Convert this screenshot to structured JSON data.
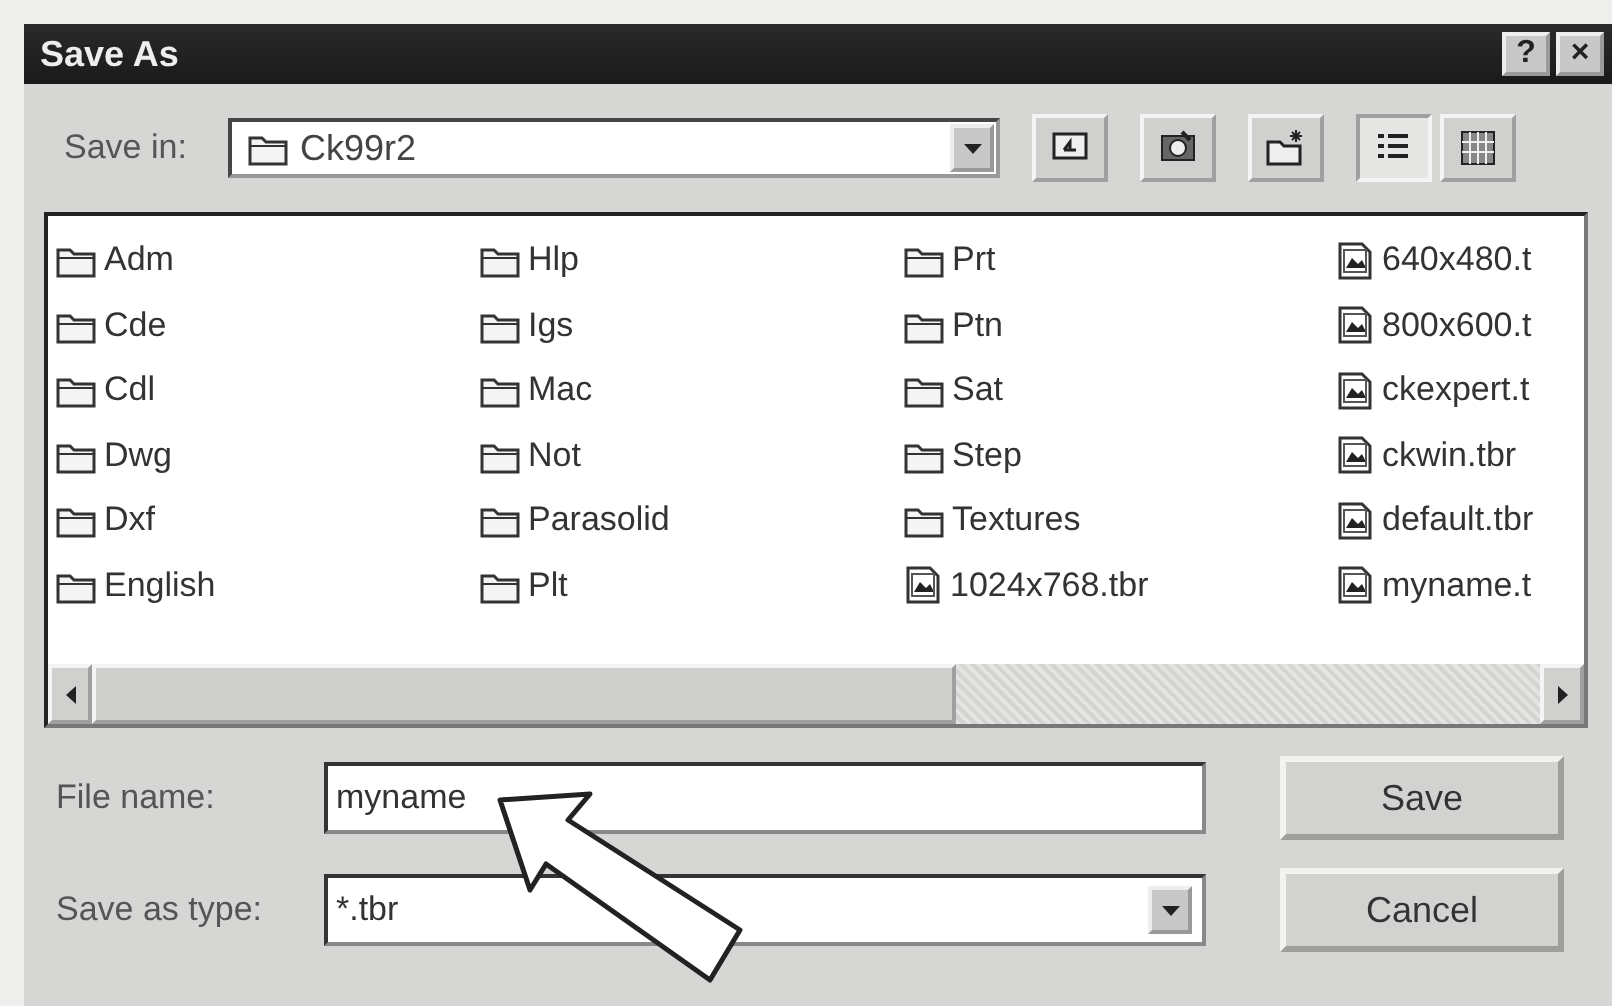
{
  "window": {
    "title": "Save As",
    "help_button": "?",
    "close_button": "×"
  },
  "save_in": {
    "label": "Save in:",
    "value": "Ck99r2"
  },
  "files": [
    {
      "kind": "folder",
      "name": "Adm"
    },
    {
      "kind": "folder",
      "name": "Cde"
    },
    {
      "kind": "folder",
      "name": "Cdl"
    },
    {
      "kind": "folder",
      "name": "Dwg"
    },
    {
      "kind": "folder",
      "name": "Dxf"
    },
    {
      "kind": "folder",
      "name": "English"
    },
    {
      "kind": "folder",
      "name": "Hlp"
    },
    {
      "kind": "folder",
      "name": "Igs"
    },
    {
      "kind": "folder",
      "name": "Mac"
    },
    {
      "kind": "folder",
      "name": "Not"
    },
    {
      "kind": "folder",
      "name": "Parasolid"
    },
    {
      "kind": "folder",
      "name": "Plt"
    },
    {
      "kind": "folder",
      "name": "Prt"
    },
    {
      "kind": "folder",
      "name": "Ptn"
    },
    {
      "kind": "folder",
      "name": "Sat"
    },
    {
      "kind": "folder",
      "name": "Step"
    },
    {
      "kind": "folder",
      "name": "Textures"
    },
    {
      "kind": "file",
      "name": "1024x768.tbr"
    },
    {
      "kind": "file",
      "name": "640x480.t"
    },
    {
      "kind": "file",
      "name": "800x600.t"
    },
    {
      "kind": "file",
      "name": "ckexpert.t"
    },
    {
      "kind": "file",
      "name": "ckwin.tbr"
    },
    {
      "kind": "file",
      "name": "default.tbr"
    },
    {
      "kind": "file",
      "name": "myname.t"
    }
  ],
  "file_name": {
    "label": "File name:",
    "value": "myname"
  },
  "save_as_type": {
    "label": "Save as type:",
    "value": "*.tbr"
  },
  "buttons": [
    "Save",
    "Cancel"
  ]
}
